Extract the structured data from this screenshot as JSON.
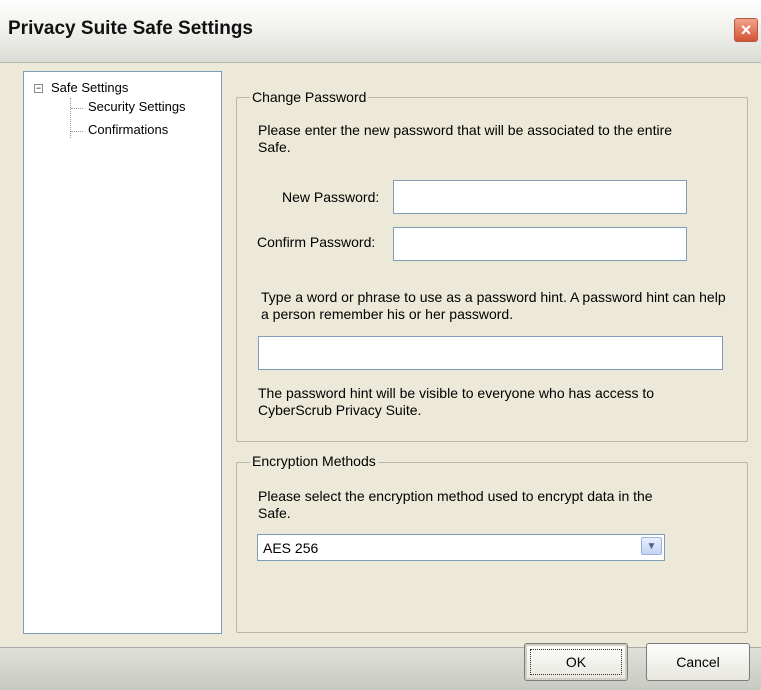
{
  "window": {
    "title": "Privacy Suite Safe Settings",
    "close_symbol": "×"
  },
  "tree": {
    "toggle_symbol": "−",
    "root_label": "Safe Settings",
    "children": [
      "Security Settings",
      "Confirmations"
    ]
  },
  "change_password": {
    "legend": "Change Password",
    "instruction": "Please enter the new password that will be associated to the entire Safe.",
    "new_password_label": "New Password:",
    "new_password_value": "",
    "confirm_password_label": "Confirm Password:",
    "confirm_password_value": "",
    "hint_instruction": "Type a word or phrase to use as a password hint. A password hint can help a person remember his or her password.",
    "hint_value": "",
    "hint_note": "The password hint will be visible to everyone who has access to CyberScrub Privacy Suite."
  },
  "encryption": {
    "legend": "Encryption Methods",
    "instruction": "Please select the encryption method used to encrypt data in the Safe.",
    "selected": "AES 256",
    "arrow_symbol": "▼"
  },
  "buttons": {
    "ok": "OK",
    "cancel": "Cancel"
  }
}
